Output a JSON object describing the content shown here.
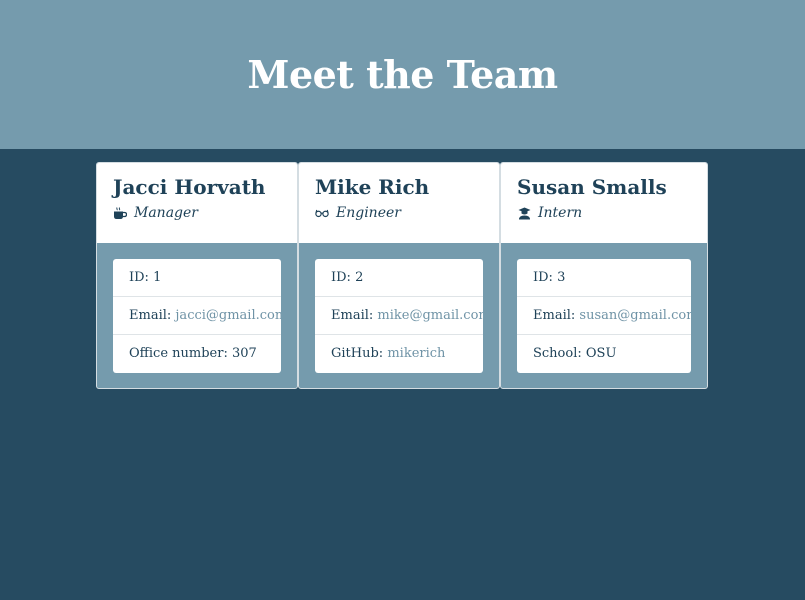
{
  "header": {
    "title": "Meet the Team"
  },
  "colors": {
    "page_background": "#264b61",
    "hero_background": "#759bad",
    "card_text": "#1f4258",
    "link": "#6f93a6"
  },
  "team": [
    {
      "name": "Jacci Horvath",
      "role": "Manager",
      "role_icon": "coffee-icon",
      "id_label": "ID:",
      "id_value": "1",
      "email_label": "Email:",
      "email": "jacci@gmail.com",
      "extra_label": "Office number:",
      "extra_value": "307"
    },
    {
      "name": "Mike Rich",
      "role": "Engineer",
      "role_icon": "glasses-icon",
      "id_label": "ID:",
      "id_value": "2",
      "email_label": "Email:",
      "email": "mike@gmail.com",
      "extra_label": "GitHub:",
      "extra_value": "mikerich"
    },
    {
      "name": "Susan Smalls",
      "role": "Intern",
      "role_icon": "graduate-icon",
      "id_label": "ID:",
      "id_value": "3",
      "email_label": "Email:",
      "email": "susan@gmail.com",
      "extra_label": "School:",
      "extra_value": "OSU"
    }
  ]
}
